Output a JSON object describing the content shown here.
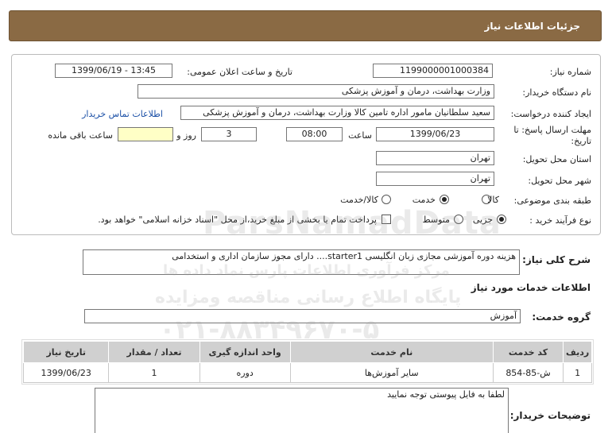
{
  "header": {
    "title": "جزئیات اطلاعات نیاز"
  },
  "fields": {
    "need_number_label": "شماره نیاز:",
    "need_number": "1199000001000384",
    "announce_label": "تاریخ و ساعت اعلان عمومی:",
    "announce_value": "1399/06/19 - 13:45",
    "buyer_org_label": "نام دستگاه خریدار:",
    "buyer_org": "وزارت بهداشت، درمان و آموزش پزشکی",
    "requester_label": "ایجاد کننده درخواست:",
    "requester": "سعید سلطانیان مامور اداره تامین کالا وزارت بهداشت، درمان و آموزش پزشکی",
    "contact_link": "اطلاعات تماس خریدار",
    "deadline_label": "مهلت ارسال پاسخ: تا تاریخ:",
    "deadline_date": "1399/06/23",
    "time_label": "ساعت",
    "deadline_time": "08:00",
    "days_value": "3",
    "days_label": "روز و",
    "remaining_value": "",
    "remaining_label": "ساعت باقی مانده",
    "province_label": "استان محل تحویل:",
    "province": "تهران",
    "city_label": "شهر محل تحویل:",
    "city": "تهران",
    "category_label": "طبقه بندی موضوعی:",
    "category_options": [
      "کالا",
      "خدمت",
      "کالا/خدمت"
    ],
    "category_selected": "خدمت",
    "process_label": "نوع فرآیند خرید :",
    "process_options": [
      "جزیی",
      "متوسط"
    ],
    "process_selected": "جزیی",
    "payment_note": "پرداخت تمام یا بخشی از مبلغ خرید،از محل \"اسناد خزانه اسلامی\" خواهد بود."
  },
  "description": {
    "label": "شرح کلی نیاز:",
    "value": "هزینه دوره آموزشی مجازی زبان انگلیسی starter1.... دارای مجوز سازمان اداری و استخدامی"
  },
  "services": {
    "section_title": "اطلاعات خدمات مورد نیاز",
    "group_label": "گروه خدمت:",
    "group_value": "آموزش",
    "columns": [
      "ردیف",
      "کد خدمت",
      "نام خدمت",
      "واحد اندازه گیری",
      "تعداد / مقدار",
      "تاریخ نیاز"
    ],
    "rows": [
      [
        "1",
        "ش-85-854",
        "سایر آموزش‌ها",
        "دوره",
        "1",
        "1399/06/23"
      ]
    ]
  },
  "notes": {
    "label": "توضیحات خریدار:",
    "value": "لطفا به فایل پیوستی توجه نمایید"
  },
  "watermark": {
    "brand": "ParsNamadData",
    "line1": "مرکز فرآوری اطلاعات پارس نماد داده ها",
    "line2": "پایگاه اطلاع رسانی مناقصه ومزایده",
    "phone": "۰۲۱-۸۸۳۴۹۶۷۰-۵"
  }
}
